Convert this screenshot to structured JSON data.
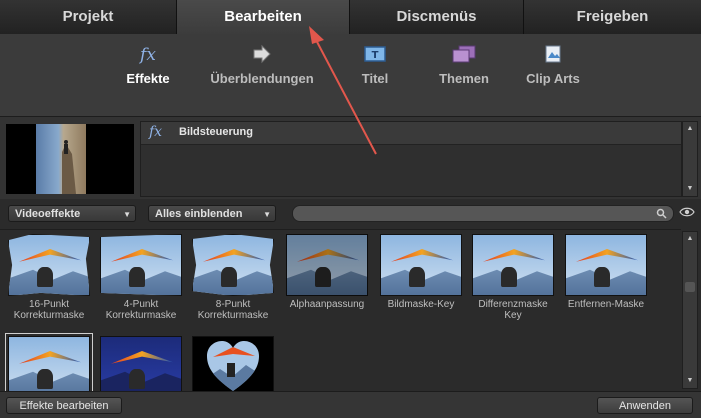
{
  "tabs": [
    {
      "label": "Projekt"
    },
    {
      "label": "Bearbeiten"
    },
    {
      "label": "Discmenüs"
    },
    {
      "label": "Freigeben"
    }
  ],
  "toolbar": {
    "items": [
      {
        "label": "Effekte",
        "icon": "fx-icon"
      },
      {
        "label": "Überblendungen",
        "icon": "transition-arrow-icon"
      },
      {
        "label": "Titel",
        "icon": "title-icon"
      },
      {
        "label": "Themen",
        "icon": "themes-icon"
      },
      {
        "label": "Clip Arts",
        "icon": "clipart-icon"
      }
    ],
    "fx_glyph": "fx"
  },
  "preview": {
    "info_icon": "fx",
    "info_label": "Bildsteuerung"
  },
  "filters": {
    "category": "Videoeffekte",
    "show": "Alles einblenden",
    "search_placeholder": ""
  },
  "effects": [
    {
      "label": "16-Punkt\nKorrekturmaske"
    },
    {
      "label": "4-Punkt\nKorrekturmaske"
    },
    {
      "label": "8-Punkt\nKorrekturmaske"
    },
    {
      "label": "Alphaanpassung"
    },
    {
      "label": "Bildmaske-Key"
    },
    {
      "label": "Differenzmaske\nKey"
    },
    {
      "label": "Entfernen-Maske"
    },
    {
      "label": ""
    },
    {
      "label": ""
    },
    {
      "label": ""
    }
  ],
  "bottom": {
    "edit_effects": "Effekte bearbeiten",
    "apply": "Anwenden"
  },
  "colors": {
    "annotation_arrow": "#e2574c",
    "active_tab": "#444444",
    "background": "#2b2b2b"
  }
}
